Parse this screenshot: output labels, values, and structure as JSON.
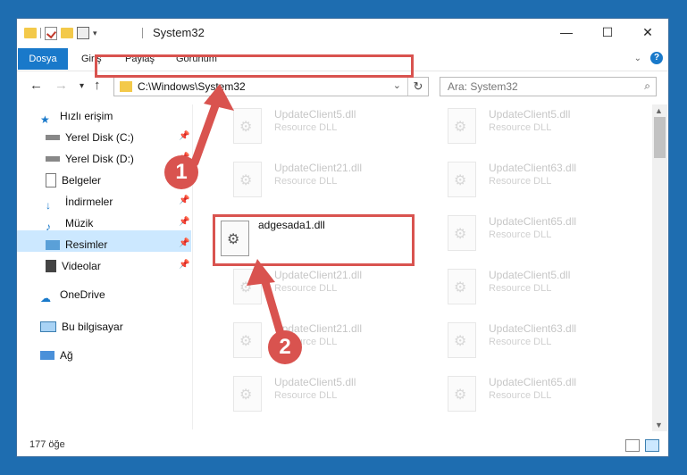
{
  "window": {
    "title": "System32"
  },
  "ribbon": {
    "tabs": [
      "Dosya",
      "Giriş",
      "Paylaş",
      "Görünüm"
    ],
    "help": "?"
  },
  "address": {
    "path": "C:\\Windows\\System32",
    "search_placeholder": "Ara: System32"
  },
  "sidebar": {
    "items": [
      {
        "label": "Hızlı erişim",
        "icon": "star-icon",
        "pinned": false
      },
      {
        "label": "Yerel Disk (C:)",
        "icon": "drive-icon",
        "pinned": true
      },
      {
        "label": "Yerel Disk (D:)",
        "icon": "drive-icon",
        "pinned": true
      },
      {
        "label": "Belgeler",
        "icon": "document-icon",
        "pinned": true
      },
      {
        "label": "İndirmeler",
        "icon": "download-icon",
        "pinned": true
      },
      {
        "label": "Müzik",
        "icon": "music-icon",
        "pinned": true
      },
      {
        "label": "Resimler",
        "icon": "pictures-icon",
        "pinned": true
      },
      {
        "label": "Videolar",
        "icon": "video-icon",
        "pinned": true
      },
      {
        "label": "OneDrive",
        "icon": "cloud-icon",
        "pinned": false
      },
      {
        "label": "Bu bilgisayar",
        "icon": "computer-icon",
        "pinned": false,
        "selected": true
      },
      {
        "label": "Ağ",
        "icon": "network-icon",
        "pinned": false
      }
    ]
  },
  "files": {
    "highlighted": {
      "name": "adgesada1.dll"
    },
    "faded": [
      {
        "name": "UpdateClient5.dll",
        "type": "Resource DLL"
      },
      {
        "name": "UpdateClient5.dll",
        "type": "Resource DLL"
      },
      {
        "name": "UpdateClient21.dll",
        "type": "Resource DLL"
      },
      {
        "name": "UpdateClient63.dll",
        "type": "Resource DLL"
      },
      {
        "name": "UpdateClient65.dll",
        "type": "Resource DLL"
      },
      {
        "name": "UpdateClient21.dll",
        "type": "Resource DLL"
      },
      {
        "name": "UpdateClient5.dll",
        "type": "Resource DLL"
      },
      {
        "name": "UpdateClient21.dll",
        "type": "Resource DLL"
      },
      {
        "name": "UpdateClient63.dll",
        "type": "Resource DLL"
      },
      {
        "name": "UpdateClient5.dll",
        "type": "Resource DLL"
      },
      {
        "name": "UpdateClient65.dll",
        "type": "Resource DLL"
      }
    ]
  },
  "status": {
    "count": "177 öğe"
  },
  "annotations": {
    "step1": "1",
    "step2": "2",
    "color": "#d9534f"
  }
}
